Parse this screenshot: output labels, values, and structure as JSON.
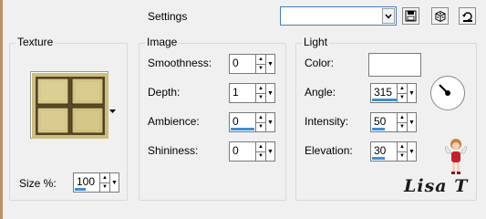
{
  "settings": {
    "label": "Settings",
    "preset_value": ""
  },
  "texture": {
    "title": "Texture",
    "size_label": "Size %:",
    "size_value": "100"
  },
  "image": {
    "title": "Image",
    "fields": [
      {
        "label": "Smoothness:",
        "value": "0"
      },
      {
        "label": "Depth:",
        "value": "1"
      },
      {
        "label": "Ambience:",
        "value": "0"
      },
      {
        "label": "Shininess:",
        "value": "0"
      }
    ]
  },
  "light": {
    "title": "Light",
    "color_label": "Color:",
    "color_value": "#ffffff",
    "fields": [
      {
        "label": "Angle:",
        "value": "315"
      },
      {
        "label": "Intensity:",
        "value": "50"
      },
      {
        "label": "Elevation:",
        "value": "30"
      }
    ]
  },
  "watermark": {
    "text": "Lisa T"
  },
  "colors": {
    "accent": "#3c8fdd",
    "texture_fill": "#c9b97a",
    "edge": "#b9926a"
  },
  "icons": [
    "save-icon",
    "dice-icon",
    "reset-icon",
    "chevron-down-icon",
    "spin-up-icon",
    "spin-down-icon",
    "dial-icon"
  ]
}
